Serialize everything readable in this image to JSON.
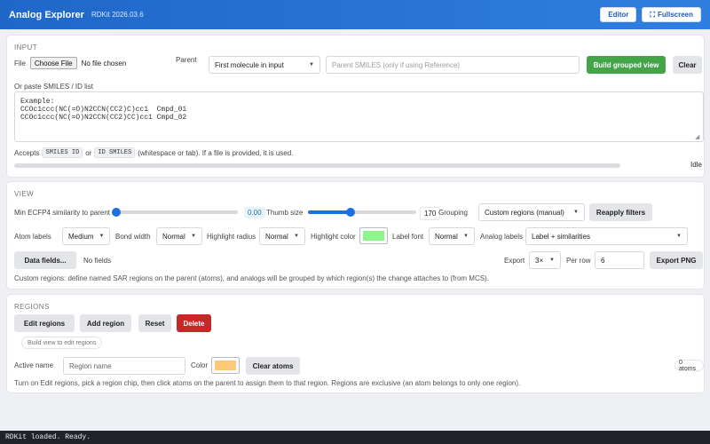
{
  "app": {
    "title": "Analog Explorer",
    "version": "RDKit 2026.03.6",
    "editor_label": "Editor",
    "fullscreen_label": "Fullscreen"
  },
  "input": {
    "section_title": "INPUT",
    "file_label": "File",
    "choose_file_label": "Choose File",
    "no_file_text": "No file chosen",
    "parent_label": "Parent",
    "parent_select": "First molecule in input",
    "parent_smiles_placeholder": "Parent SMILES (only if using Reference)",
    "build_label": "Build grouped view",
    "clear_label": "Clear",
    "paste_label": "Or paste SMILES / ID list",
    "textarea_text": "Example:\nCCOc1ccc(NC(=O)N2CCN(CC2)C)cc1  Cmpd_01\nCCOc1ccc(NC(=O)N2CCN(CC2)CC)cc1 Cmpd_02",
    "accepts_prefix": "Accepts",
    "fmt1": "SMILES ID",
    "or_text": "or",
    "fmt2": "ID SMILES",
    "accepts_suffix": "(whitespace or tab). If a file is provided, it is used.",
    "progress": 0,
    "status": "Idle"
  },
  "view": {
    "section_title": "VIEW",
    "min_sim_label": "Min ECFP4 similarity to parent",
    "min_sim_value": "0.00",
    "min_sim_fraction": 0.0,
    "thumb_label": "Thumb size",
    "thumb_value": "170",
    "thumb_fraction": 0.38,
    "grouping_label": "Grouping",
    "grouping_select": "Custom regions (manual)",
    "reapply_label": "Reapply filters",
    "atom_labels_label": "Atom labels",
    "atom_labels_select": "Medium",
    "bond_width_label": "Bond width",
    "bond_width_select": "Normal",
    "highlight_radius_label": "Highlight radius",
    "highlight_radius_select": "Normal",
    "highlight_color_label": "Highlight color",
    "highlight_color": "#8ef58a",
    "label_font_label": "Label font",
    "label_font_select": "Normal",
    "analog_labels_label": "Analog labels",
    "analog_labels_select": "Label + similarities",
    "data_fields_label": "Data fields...",
    "no_fields_text": "No fields",
    "export_label": "Export",
    "export_scale": "3×",
    "per_row_label": "Per row",
    "per_row_value": "6",
    "export_png_label": "Export PNG",
    "note": "Custom regions: define named SAR regions on the parent (atoms), and analogs will be grouped by which region(s) the change attaches to (from MCS)."
  },
  "regions": {
    "section_title": "REGIONS",
    "edit_label": "Edit regions",
    "add_label": "Add region",
    "reset_label": "Reset",
    "delete_label": "Delete",
    "chip_text": "Build view to edit regions",
    "active_name_label": "Active name",
    "region_name_placeholder": "Region name",
    "color_label": "Color",
    "region_color": "#ffc97a",
    "clear_atoms_label": "Clear atoms",
    "atoms_count": "0 atoms",
    "note": "Turn on Edit regions, pick a region chip, then click atoms on the parent to assign them to that region. Regions are exclusive (an atom belongs to only one region)."
  },
  "status_line": "RDKit loaded. Ready."
}
